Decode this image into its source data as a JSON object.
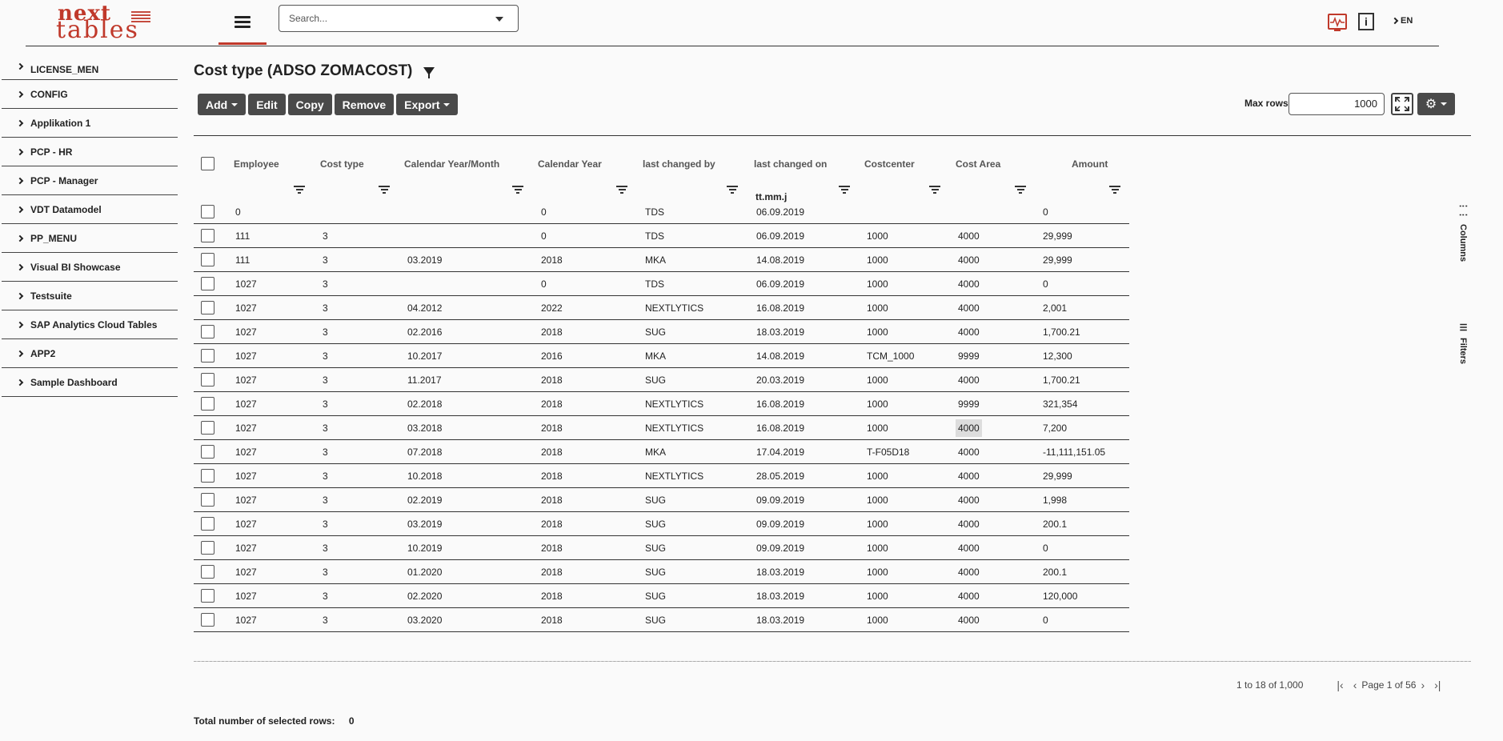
{
  "header": {
    "logo_top": "next",
    "logo_bottom": "tables",
    "search_placeholder": "Search...",
    "lang": "EN"
  },
  "sidebar": {
    "items": [
      {
        "label": "LICENSE_MEN"
      },
      {
        "label": "CONFIG"
      },
      {
        "label": "Applikation 1"
      },
      {
        "label": "PCP - HR"
      },
      {
        "label": "PCP - Manager"
      },
      {
        "label": "VDT Datamodel"
      },
      {
        "label": "PP_MENU"
      },
      {
        "label": "Visual BI Showcase"
      },
      {
        "label": "Testsuite"
      },
      {
        "label": "SAP Analytics Cloud Tables"
      },
      {
        "label": "APP2"
      },
      {
        "label": "Sample Dashboard"
      }
    ]
  },
  "main": {
    "title": "Cost type (ADSO ZOMACOST)",
    "toolbar": {
      "add": "Add",
      "edit": "Edit",
      "copy": "Copy",
      "remove": "Remove",
      "export": "Export"
    },
    "max_rows_label": "Max rows",
    "max_rows_value": "1000",
    "side_tabs": {
      "columns": "Columns",
      "filters": "Filters"
    }
  },
  "table": {
    "columns": [
      "Employee",
      "Cost type",
      "Calendar Year/Month",
      "Calendar Year",
      "last changed by",
      "last changed on",
      "Costcenter",
      "Cost Area",
      "Amount"
    ],
    "filter_value_last_changed_on": "tt.mm.j",
    "rows": [
      [
        "0",
        "",
        "",
        "0",
        "TDS",
        "06.09.2019",
        "",
        "",
        "0"
      ],
      [
        "111",
        "3",
        "",
        "0",
        "TDS",
        "06.09.2019",
        "1000",
        "4000",
        "29,999"
      ],
      [
        "111",
        "3",
        "03.2019",
        "2018",
        "MKA",
        "14.08.2019",
        "1000",
        "4000",
        "29,999"
      ],
      [
        "1027",
        "3",
        "",
        "0",
        "TDS",
        "06.09.2019",
        "1000",
        "4000",
        "0"
      ],
      [
        "1027",
        "3",
        "04.2012",
        "2022",
        "NEXTLYTICS",
        "16.08.2019",
        "1000",
        "4000",
        "2,001"
      ],
      [
        "1027",
        "3",
        "02.2016",
        "2018",
        "SUG",
        "18.03.2019",
        "1000",
        "4000",
        "1,700.21"
      ],
      [
        "1027",
        "3",
        "10.2017",
        "2016",
        "MKA",
        "14.08.2019",
        "TCM_1000",
        "9999",
        "12,300"
      ],
      [
        "1027",
        "3",
        "11.2017",
        "2018",
        "SUG",
        "20.03.2019",
        "1000",
        "4000",
        "1,700.21"
      ],
      [
        "1027",
        "3",
        "02.2018",
        "2018",
        "NEXTLYTICS",
        "16.08.2019",
        "1000",
        "9999",
        "321,354"
      ],
      [
        "1027",
        "3",
        "03.2018",
        "2018",
        "NEXTLYTICS",
        "16.08.2019",
        "1000",
        "4000",
        "7,200"
      ],
      [
        "1027",
        "3",
        "07.2018",
        "2018",
        "MKA",
        "17.04.2019",
        "T-F05D18",
        "4000",
        "-11,111,151.05"
      ],
      [
        "1027",
        "3",
        "10.2018",
        "2018",
        "NEXTLYTICS",
        "28.05.2019",
        "1000",
        "4000",
        "29,999"
      ],
      [
        "1027",
        "3",
        "02.2019",
        "2018",
        "SUG",
        "09.09.2019",
        "1000",
        "4000",
        "1,998"
      ],
      [
        "1027",
        "3",
        "03.2019",
        "2018",
        "SUG",
        "09.09.2019",
        "1000",
        "4000",
        "200.1"
      ],
      [
        "1027",
        "3",
        "10.2019",
        "2018",
        "SUG",
        "09.09.2019",
        "1000",
        "4000",
        "0"
      ],
      [
        "1027",
        "3",
        "01.2020",
        "2018",
        "SUG",
        "18.03.2019",
        "1000",
        "4000",
        "200.1"
      ],
      [
        "1027",
        "3",
        "02.2020",
        "2018",
        "SUG",
        "18.03.2019",
        "1000",
        "4000",
        "120,000"
      ],
      [
        "1027",
        "3",
        "03.2020",
        "2018",
        "SUG",
        "18.03.2019",
        "1000",
        "4000",
        "0"
      ]
    ]
  },
  "pager": {
    "range": "1 to 18 of 1,000",
    "page": "Page 1 of 56"
  },
  "footer": {
    "label": "Total number of selected rows:",
    "value": "0"
  },
  "colors": {
    "brand": "#c0392b",
    "button": "#4a4a4a"
  }
}
